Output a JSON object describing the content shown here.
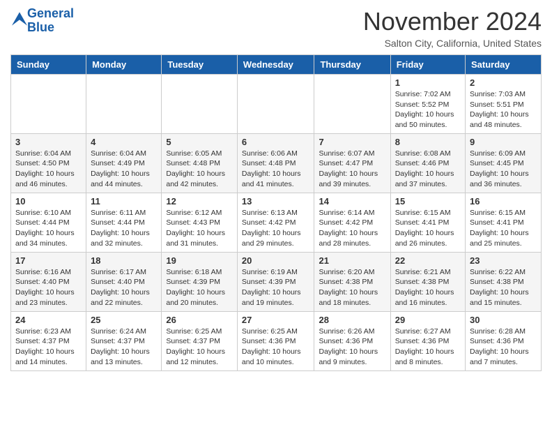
{
  "header": {
    "logo_line1": "General",
    "logo_line2": "Blue",
    "month_year": "November 2024",
    "location": "Salton City, California, United States"
  },
  "weekdays": [
    "Sunday",
    "Monday",
    "Tuesday",
    "Wednesday",
    "Thursday",
    "Friday",
    "Saturday"
  ],
  "weeks": [
    [
      {
        "day": "",
        "info": ""
      },
      {
        "day": "",
        "info": ""
      },
      {
        "day": "",
        "info": ""
      },
      {
        "day": "",
        "info": ""
      },
      {
        "day": "",
        "info": ""
      },
      {
        "day": "1",
        "info": "Sunrise: 7:02 AM\nSunset: 5:52 PM\nDaylight: 10 hours\nand 50 minutes."
      },
      {
        "day": "2",
        "info": "Sunrise: 7:03 AM\nSunset: 5:51 PM\nDaylight: 10 hours\nand 48 minutes."
      }
    ],
    [
      {
        "day": "3",
        "info": "Sunrise: 6:04 AM\nSunset: 4:50 PM\nDaylight: 10 hours\nand 46 minutes."
      },
      {
        "day": "4",
        "info": "Sunrise: 6:04 AM\nSunset: 4:49 PM\nDaylight: 10 hours\nand 44 minutes."
      },
      {
        "day": "5",
        "info": "Sunrise: 6:05 AM\nSunset: 4:48 PM\nDaylight: 10 hours\nand 42 minutes."
      },
      {
        "day": "6",
        "info": "Sunrise: 6:06 AM\nSunset: 4:48 PM\nDaylight: 10 hours\nand 41 minutes."
      },
      {
        "day": "7",
        "info": "Sunrise: 6:07 AM\nSunset: 4:47 PM\nDaylight: 10 hours\nand 39 minutes."
      },
      {
        "day": "8",
        "info": "Sunrise: 6:08 AM\nSunset: 4:46 PM\nDaylight: 10 hours\nand 37 minutes."
      },
      {
        "day": "9",
        "info": "Sunrise: 6:09 AM\nSunset: 4:45 PM\nDaylight: 10 hours\nand 36 minutes."
      }
    ],
    [
      {
        "day": "10",
        "info": "Sunrise: 6:10 AM\nSunset: 4:44 PM\nDaylight: 10 hours\nand 34 minutes."
      },
      {
        "day": "11",
        "info": "Sunrise: 6:11 AM\nSunset: 4:44 PM\nDaylight: 10 hours\nand 32 minutes."
      },
      {
        "day": "12",
        "info": "Sunrise: 6:12 AM\nSunset: 4:43 PM\nDaylight: 10 hours\nand 31 minutes."
      },
      {
        "day": "13",
        "info": "Sunrise: 6:13 AM\nSunset: 4:42 PM\nDaylight: 10 hours\nand 29 minutes."
      },
      {
        "day": "14",
        "info": "Sunrise: 6:14 AM\nSunset: 4:42 PM\nDaylight: 10 hours\nand 28 minutes."
      },
      {
        "day": "15",
        "info": "Sunrise: 6:15 AM\nSunset: 4:41 PM\nDaylight: 10 hours\nand 26 minutes."
      },
      {
        "day": "16",
        "info": "Sunrise: 6:15 AM\nSunset: 4:41 PM\nDaylight: 10 hours\nand 25 minutes."
      }
    ],
    [
      {
        "day": "17",
        "info": "Sunrise: 6:16 AM\nSunset: 4:40 PM\nDaylight: 10 hours\nand 23 minutes."
      },
      {
        "day": "18",
        "info": "Sunrise: 6:17 AM\nSunset: 4:40 PM\nDaylight: 10 hours\nand 22 minutes."
      },
      {
        "day": "19",
        "info": "Sunrise: 6:18 AM\nSunset: 4:39 PM\nDaylight: 10 hours\nand 20 minutes."
      },
      {
        "day": "20",
        "info": "Sunrise: 6:19 AM\nSunset: 4:39 PM\nDaylight: 10 hours\nand 19 minutes."
      },
      {
        "day": "21",
        "info": "Sunrise: 6:20 AM\nSunset: 4:38 PM\nDaylight: 10 hours\nand 18 minutes."
      },
      {
        "day": "22",
        "info": "Sunrise: 6:21 AM\nSunset: 4:38 PM\nDaylight: 10 hours\nand 16 minutes."
      },
      {
        "day": "23",
        "info": "Sunrise: 6:22 AM\nSunset: 4:38 PM\nDaylight: 10 hours\nand 15 minutes."
      }
    ],
    [
      {
        "day": "24",
        "info": "Sunrise: 6:23 AM\nSunset: 4:37 PM\nDaylight: 10 hours\nand 14 minutes."
      },
      {
        "day": "25",
        "info": "Sunrise: 6:24 AM\nSunset: 4:37 PM\nDaylight: 10 hours\nand 13 minutes."
      },
      {
        "day": "26",
        "info": "Sunrise: 6:25 AM\nSunset: 4:37 PM\nDaylight: 10 hours\nand 12 minutes."
      },
      {
        "day": "27",
        "info": "Sunrise: 6:25 AM\nSunset: 4:36 PM\nDaylight: 10 hours\nand 10 minutes."
      },
      {
        "day": "28",
        "info": "Sunrise: 6:26 AM\nSunset: 4:36 PM\nDaylight: 10 hours\nand 9 minutes."
      },
      {
        "day": "29",
        "info": "Sunrise: 6:27 AM\nSunset: 4:36 PM\nDaylight: 10 hours\nand 8 minutes."
      },
      {
        "day": "30",
        "info": "Sunrise: 6:28 AM\nSunset: 4:36 PM\nDaylight: 10 hours\nand 7 minutes."
      }
    ]
  ]
}
